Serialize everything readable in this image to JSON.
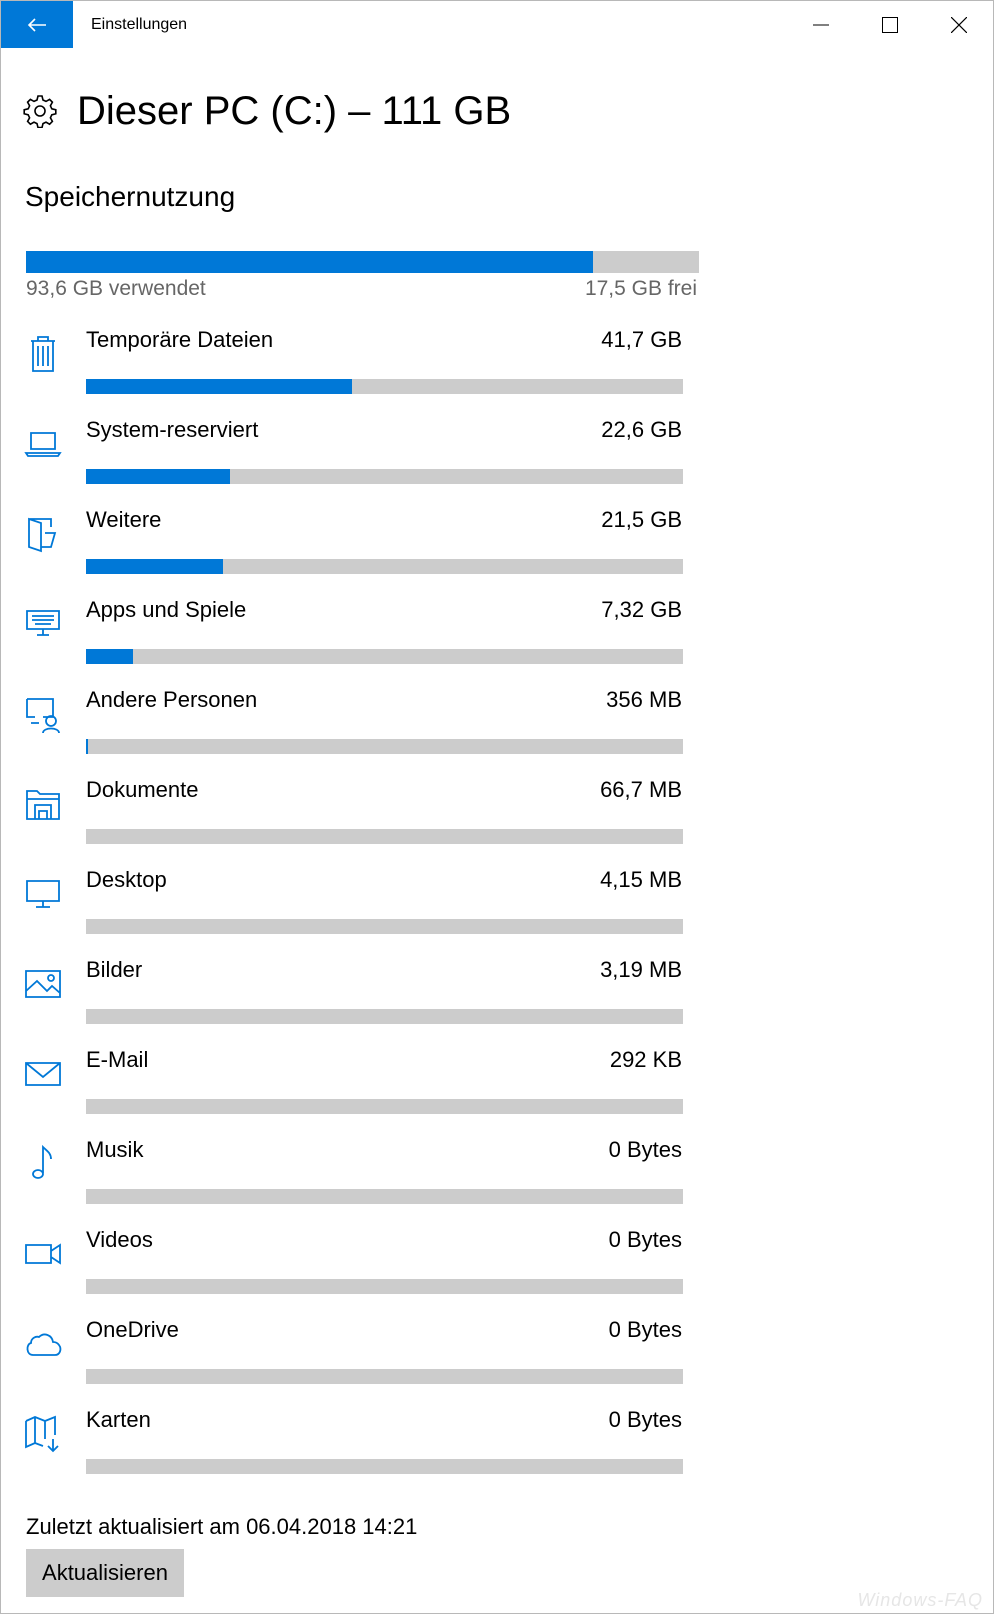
{
  "window": {
    "title": "Einstellungen"
  },
  "header": {
    "title": "Dieser PC (C:) – 111 GB",
    "icon": "gear-icon"
  },
  "usage": {
    "section_title": "Speichernutzung",
    "used_label": "93,6 GB verwendet",
    "free_label": "17,5 GB frei",
    "used_fraction": 0.842
  },
  "categories": [
    {
      "name": "Temporäre Dateien",
      "size": "41,7 GB",
      "fraction": 0.445,
      "icon": "trash-icon"
    },
    {
      "name": "System-reserviert",
      "size": "22,6 GB",
      "fraction": 0.242,
      "icon": "laptop-icon"
    },
    {
      "name": "Weitere",
      "size": "21,5 GB",
      "fraction": 0.23,
      "icon": "folder-open-icon"
    },
    {
      "name": "Apps und Spiele",
      "size": "7,32 GB",
      "fraction": 0.078,
      "icon": "keyboard-icon"
    },
    {
      "name": "Andere Personen",
      "size": "356 MB",
      "fraction": 0.004,
      "icon": "user-monitor-icon"
    },
    {
      "name": "Dokumente",
      "size": "66,7 MB",
      "fraction": 0,
      "icon": "documents-icon"
    },
    {
      "name": "Desktop",
      "size": "4,15 MB",
      "fraction": 0,
      "icon": "desktop-icon"
    },
    {
      "name": "Bilder",
      "size": "3,19 MB",
      "fraction": 0,
      "icon": "picture-icon"
    },
    {
      "name": "E-Mail",
      "size": "292 KB",
      "fraction": 0,
      "icon": "mail-icon"
    },
    {
      "name": "Musik",
      "size": "0 Bytes",
      "fraction": 0,
      "icon": "music-icon"
    },
    {
      "name": "Videos",
      "size": "0 Bytes",
      "fraction": 0,
      "icon": "video-icon"
    },
    {
      "name": "OneDrive",
      "size": "0 Bytes",
      "fraction": 0,
      "icon": "cloud-icon"
    },
    {
      "name": "Karten",
      "size": "0 Bytes",
      "fraction": 0,
      "icon": "map-icon"
    }
  ],
  "footer": {
    "updated_label": "Zuletzt aktualisiert am 06.04.2018 14:21",
    "refresh_label": "Aktualisieren"
  },
  "watermark": "Windows-FAQ",
  "colors": {
    "accent": "#0078d7",
    "track": "#cccccc"
  }
}
